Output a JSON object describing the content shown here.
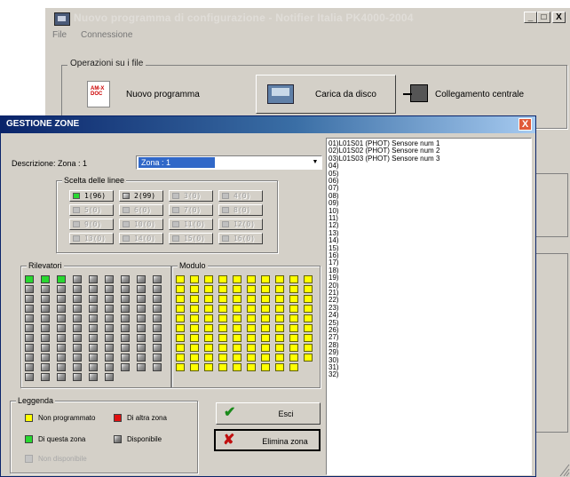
{
  "main_window": {
    "title": "Nuovo programma di configurazione - Notifier Italia PK4000-2004",
    "caption_buttons": [
      "_",
      "□",
      "X"
    ],
    "menu": [
      "File",
      "Connessione"
    ],
    "ops_group_label": "Operazioni su i file",
    "ops": {
      "nuovo_label": "Nuovo programma",
      "nuovo_icon_text": "AM-X DOC",
      "carica_label": "Carica da disco",
      "collegamento_label": "Collegamento centrale"
    }
  },
  "dialog": {
    "title": "GESTIONE ZONE",
    "close_glyph": "X",
    "description_label": "Descrizione: Zona : 1",
    "zone_select_value": "Zona : 1",
    "lines_group_label": "Scelta delle linee",
    "lines": [
      {
        "label": "1(96)",
        "state": "green"
      },
      {
        "label": "2(99)",
        "state": "grey"
      },
      {
        "label": "3(0)",
        "state": "disabled"
      },
      {
        "label": "4(0)",
        "state": "disabled"
      },
      {
        "label": "5(0)",
        "state": "disabled"
      },
      {
        "label": "6(0)",
        "state": "disabled"
      },
      {
        "label": "7(0)",
        "state": "disabled"
      },
      {
        "label": "8(0)",
        "state": "disabled"
      },
      {
        "label": "9(0)",
        "state": "disabled"
      },
      {
        "label": "10(0)",
        "state": "disabled"
      },
      {
        "label": "11(0)",
        "state": "disabled"
      },
      {
        "label": "12(0)",
        "state": "disabled"
      },
      {
        "label": "13(0)",
        "state": "disabled"
      },
      {
        "label": "14(0)",
        "state": "disabled"
      },
      {
        "label": "15(0)",
        "state": "disabled"
      },
      {
        "label": "16(0)",
        "state": "disabled"
      }
    ],
    "rilevatori_label": "Rilevatori",
    "rilevatori_green_count": 3,
    "rilevatori_total": 96,
    "modulo_label": "Modulo",
    "modulo_total": 99,
    "legend_label": "Leggenda",
    "legend": {
      "non_programmato": "Non programmato",
      "di_altra_zona": "Di altra zona",
      "di_questa_zona": "Di questa zona",
      "disponibile": "Disponibile",
      "non_disponibile": "Non disponibile"
    },
    "esci_label": "Esci",
    "elimina_label": "Elimina zona",
    "sensor_list": [
      "01)L01S01 (PHOT) Sensore num 1",
      "02)L01S02 (PHOT) Sensore num 2",
      "03)L01S03 (PHOT) Sensore num 3",
      "04)",
      "05)",
      "06)",
      "07)",
      "08)",
      "09)",
      "10)",
      "11)",
      "12)",
      "13)",
      "14)",
      "15)",
      "16)",
      "17)",
      "18)",
      "19)",
      "20)",
      "21)",
      "22)",
      "23)",
      "24)",
      "25)",
      "26)",
      "27)",
      "28)",
      "29)",
      "30)",
      "31)",
      "32)"
    ]
  },
  "colors": {
    "titlebar_start": "#0a246a",
    "titlebar_end": "#a6caf0",
    "face": "#d4d0c8",
    "this_zone": "#28d830",
    "other_zone": "#e01010",
    "not_programmed": "#ffff00"
  }
}
